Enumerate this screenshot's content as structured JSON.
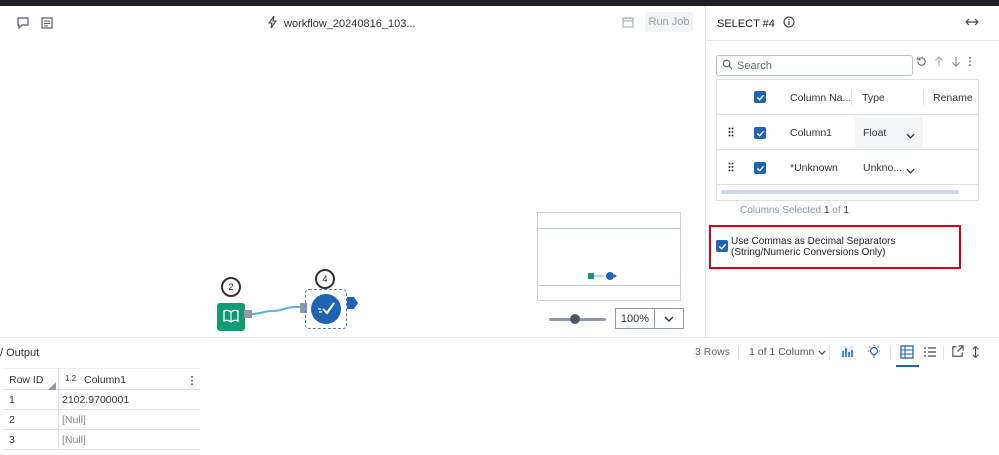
{
  "toolbar": {
    "workflow_name": "workflow_20240816_103...",
    "run_job_label": "Run Job"
  },
  "canvas": {
    "input_node_badge": "2",
    "select_node_badge": "4",
    "zoom_value": "100%"
  },
  "config": {
    "title": "SELECT #4",
    "search_placeholder": "Search",
    "headers": {
      "column_name": "Column Na...",
      "type": "Type",
      "rename": "Rename"
    },
    "rows": [
      {
        "name": "Column1",
        "type": "Float"
      },
      {
        "name": "*Unknown",
        "type": "Unkno..."
      }
    ],
    "columns_selected_prefix": "Columns Selected ",
    "columns_selected_count": "1",
    "columns_selected_of": " of ",
    "columns_selected_total": "1",
    "commas_label": "Use Commas as Decimal Separators (String/Numeric Conversions Only)"
  },
  "results": {
    "title": "/ Output",
    "row_count": "3 Rows",
    "column_selector": "1 of 1 Column",
    "table": {
      "headers": {
        "row_id": "Row ID",
        "type_badge": "1.2",
        "column1": "Column1"
      },
      "rows": [
        {
          "id": "1",
          "value": "2102.9700001"
        },
        {
          "id": "2",
          "value": "[Null]"
        },
        {
          "id": "3",
          "value": "[Null]"
        }
      ]
    }
  },
  "colors": {
    "accent": "#1f63b4",
    "input_node": "#119b75",
    "highlight": "#d0021b"
  }
}
